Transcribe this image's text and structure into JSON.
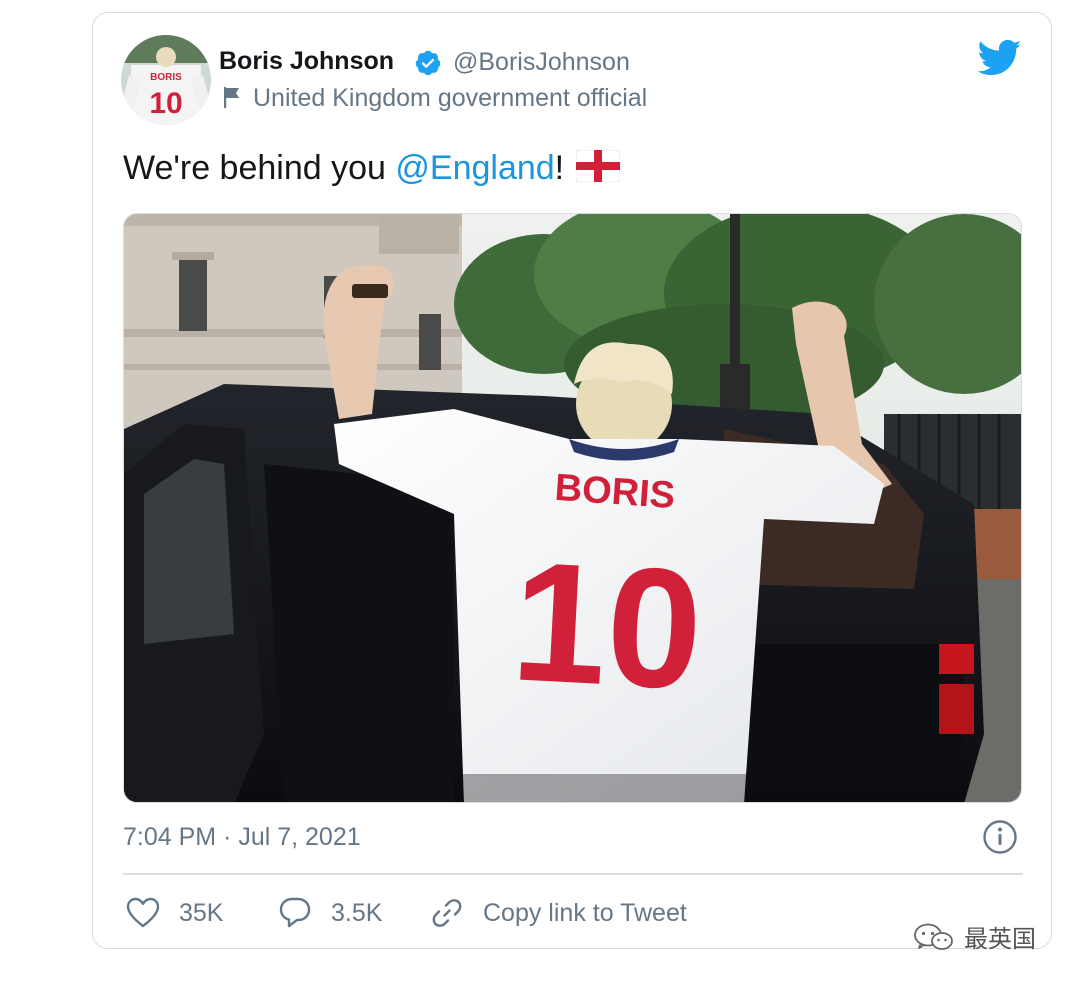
{
  "tweet": {
    "author_name": "Boris Johnson",
    "author_handle": "@BorisJohnson",
    "author_label": "United Kingdom government official",
    "text_before": "We're behind you ",
    "mention": "@England",
    "text_after": "!",
    "timestamp": "7:04 PM · Jul 7, 2021",
    "media": {
      "jersey_name": "BORIS",
      "jersey_number": "10"
    }
  },
  "actions": {
    "likes": "35K",
    "replies": "3.5K",
    "copy_link": "Copy link to Tweet"
  },
  "watermark": {
    "text": "最英国"
  },
  "icons": {
    "verified": "verified-badge-icon",
    "label_flag": "flag-icon",
    "brand": "twitter-bird-icon",
    "info": "info-icon",
    "like": "heart-icon",
    "reply": "speech-bubble-icon",
    "link": "link-icon"
  },
  "colors": {
    "mention_blue": "#1b95e0",
    "twitter_blue": "#1da1f2",
    "secondary_text": "#657786",
    "border": "#d6dde3",
    "jersey_red": "#d0203a"
  }
}
